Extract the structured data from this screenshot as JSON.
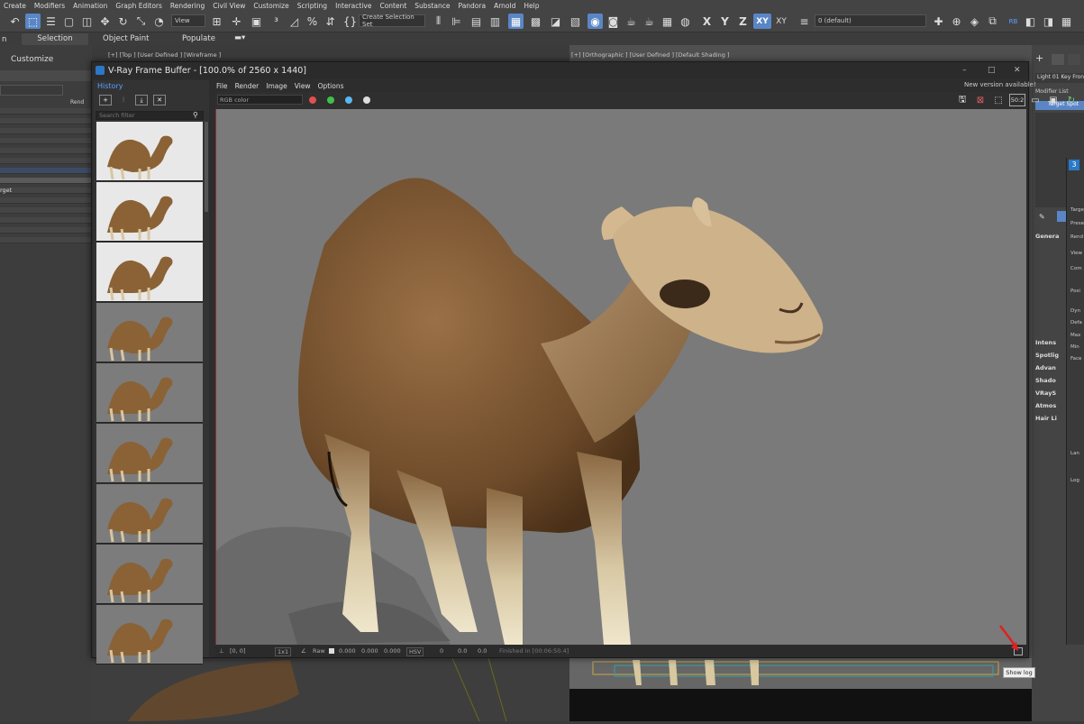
{
  "main_menu": [
    "Create",
    "Modifiers",
    "Animation",
    "Graph Editors",
    "Rendering",
    "Civil View",
    "Customize",
    "Scripting",
    "Interactive",
    "Content",
    "Substance",
    "Pandora",
    "Arnold",
    "Help"
  ],
  "toolbar": {
    "view_dropdown": "View",
    "selection_set": "Create Selection Set",
    "axis_x": "X",
    "axis_y": "Y",
    "axis_z": "Z",
    "axis_xy": "XY",
    "axis_xy2": "XY",
    "layer_dropdown": "0 (default)"
  },
  "ribbon": {
    "left_fragment": "n",
    "tab_selection": "Selection",
    "tab_object_paint": "Object Paint",
    "tab_populate": "Populate"
  },
  "explorer": {
    "customize": "Customize",
    "render_fragment": "Rend",
    "target_fragment": "rget"
  },
  "viewports": {
    "top_label": "[+] [Top ] [User Defined ] [Wireframe ]",
    "ortho_label": "[+] [Orthographic ] [User Defined ] [Default Shading ]"
  },
  "command_panel": {
    "light_name": "Light 01 Key Fron",
    "modifier_list": "Modifier List",
    "target_spot": "Target Spot",
    "rollouts": [
      "Genera",
      "Intens",
      "Spotlig",
      "Advan",
      "Shado",
      "VRayS",
      "Atmos",
      "Hair Li"
    ],
    "params": [
      "Targe",
      "Prese",
      "Rend",
      "View",
      "Com",
      "Posi",
      "Dyn",
      "Defa",
      "Max",
      "Min",
      "Face",
      "Lan",
      "Log"
    ]
  },
  "vfb": {
    "title": "V-Ray Frame Buffer - [100.0% of 2560 x 1440]",
    "history_label": "History",
    "search_placeholder": "Search filter",
    "menu": [
      "File",
      "Render",
      "Image",
      "View",
      "Options"
    ],
    "new_version": "New version available!",
    "channel": "RGB color",
    "zoom_badge": "50:2",
    "colors": {
      "red": "#e05050",
      "green": "#3ec24a",
      "blue": "#59b8f0"
    },
    "status": {
      "coords": "[0, 0]",
      "zoom": "1x1",
      "raw": "Raw",
      "v1": "0.000",
      "v2": "0.000",
      "v3": "0.000",
      "mode": "HSV",
      "h": "0",
      "s": "0.0",
      "v": "0.0",
      "finished": "Finished in [00:06:50.4]"
    },
    "tooltip": "Show log"
  }
}
